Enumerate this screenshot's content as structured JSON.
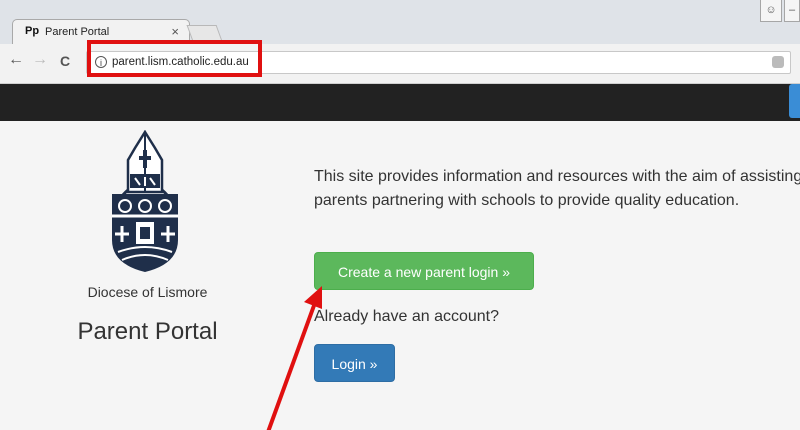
{
  "browser": {
    "tab_title": "Parent Portal",
    "favicon_text": "Pp",
    "close_symbol": "×",
    "url": "parent.lism.catholic.edu.au",
    "info_symbol": "i",
    "back_symbol": "←",
    "forward_symbol": "→",
    "reload_symbol": "C"
  },
  "sidebar": {
    "logo": "diocese-crest",
    "org_name": "Diocese of Lismore",
    "title": "Parent Portal"
  },
  "main": {
    "intro": "This site provides information and resources with the aim of assisting parents partnering with schools to provide quality education.",
    "create_button": "Create a new parent login »",
    "already_text": "Already have an account?",
    "login_button": "Login »"
  },
  "colors": {
    "nav_bar": "#222222",
    "create_button": "#5cb85c",
    "login_button": "#337ab7",
    "annotation": "#e01010"
  }
}
